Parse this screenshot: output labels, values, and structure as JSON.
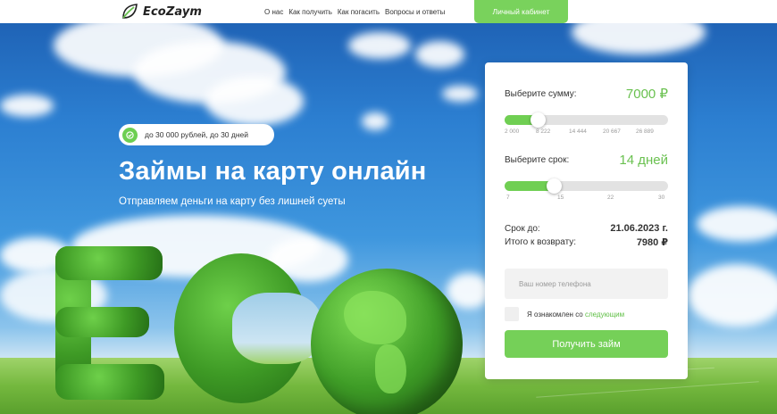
{
  "header": {
    "logo_text": "EcoZaym",
    "logo_icon": "leaf-icon",
    "nav": [
      {
        "label": "О нас"
      },
      {
        "label": "Как получить"
      },
      {
        "label": "Как погасить"
      },
      {
        "label": "Вопросы и ответы"
      }
    ],
    "cabinet_label": "Личный кабинет"
  },
  "hero": {
    "badge_text": "до 30 000 рублей, до 30 дней",
    "badge_icon": "check-circle-icon",
    "title": "Займы на карту онлайн",
    "subtitle": "Отправляем деньги на карту без лишней суеты"
  },
  "calculator": {
    "amount": {
      "label": "Выберите сумму:",
      "value": "7000 ₽",
      "fraction": 0.2,
      "ticks": [
        "2 000",
        "8 222",
        "14 444",
        "20 667",
        "26 889"
      ]
    },
    "term": {
      "label": "Выберите срок:",
      "value": "14 дней",
      "fraction": 0.3,
      "ticks": [
        "7",
        "15",
        "22",
        "30"
      ]
    },
    "due_label": "Срок до:",
    "due_value": "21.06.2023 г.",
    "total_label": "Итого к возврату:",
    "total_value": "7980 ₽",
    "phone_placeholder": "Ваш номер телефона",
    "agree_text": "Я ознакомлен со",
    "agree_link": "следующим",
    "submit_label": "Получить займ"
  },
  "colors": {
    "accent": "#75d058",
    "accent_text": "#6ac150",
    "header_bg": "#ffffff"
  }
}
